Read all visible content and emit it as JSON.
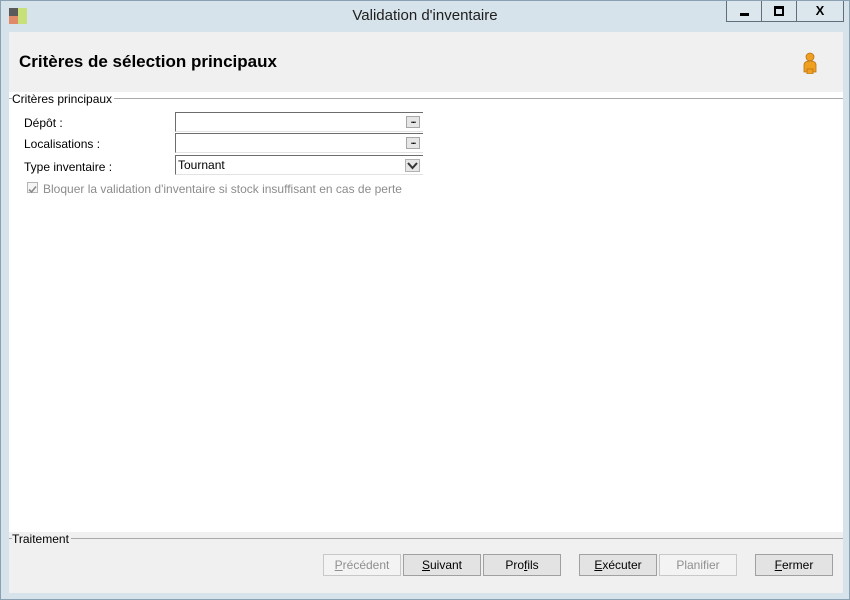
{
  "window": {
    "title": "Validation d'inventaire",
    "close_glyph": "X"
  },
  "header": {
    "title": "Critères de sélection principaux",
    "icon": "user-profile-icon"
  },
  "main_group": {
    "label": "Critères principaux",
    "fields": [
      {
        "label": "Dépôt :",
        "value": ""
      },
      {
        "label": "Localisations :",
        "value": ""
      },
      {
        "label": "Type inventaire :",
        "value": "Tournant"
      }
    ],
    "ellipsis_glyph": "...",
    "checkbox": {
      "label": "Bloquer la validation d'inventaire si stock insuffisant en cas de  perte",
      "checked": true,
      "enabled": false
    }
  },
  "traitement": {
    "label": "Traitement"
  },
  "buttons": {
    "precedent": {
      "ul": "P",
      "rest": "récédent",
      "enabled": false
    },
    "suivant": {
      "ul": "S",
      "rest": "uivant",
      "enabled": true
    },
    "profils": {
      "pre": "Pro",
      "ul": "f",
      "rest": "ils",
      "enabled": true
    },
    "executer": {
      "ul": "E",
      "rest": "xécuter",
      "enabled": true
    },
    "planifier": {
      "label": "Planifier",
      "enabled": false
    },
    "fermer": {
      "ul": "F",
      "rest": "ermer",
      "enabled": true
    }
  },
  "colors": {
    "frame": "#d7e3ea",
    "header_band": "#f0f0f0",
    "disabled_text": "#8f8f8f",
    "icon_orange": "#f0a020"
  }
}
